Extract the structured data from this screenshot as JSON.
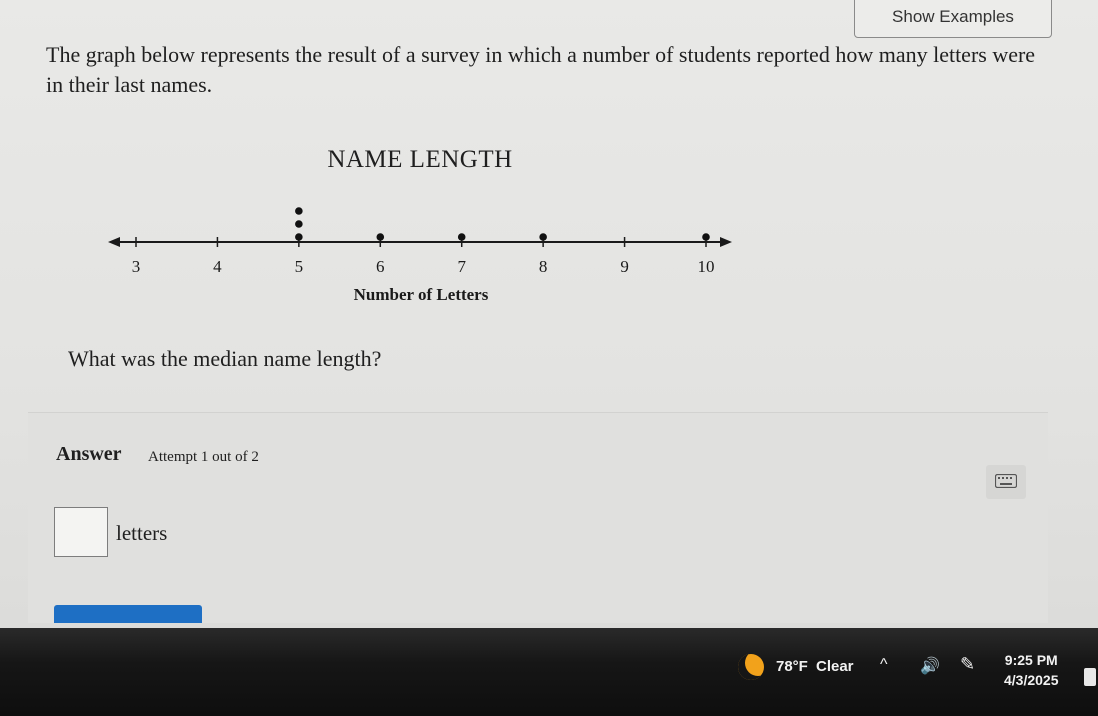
{
  "header": {
    "show_examples_label": "Show Examples"
  },
  "question": {
    "text": "The graph below represents the result of a survey in which a number of students reported how many letters were in their last names.",
    "prompt": "What was the median name length?"
  },
  "chart_data": {
    "type": "scatter",
    "subtype": "dot-plot",
    "title": "NAME LENGTH",
    "xlabel": "Number of Letters",
    "ylabel": "",
    "xlim": [
      3,
      10
    ],
    "ticks": [
      3,
      4,
      5,
      6,
      7,
      8,
      9,
      10
    ],
    "tick_labels": [
      "3",
      "4",
      "5",
      "6",
      "7",
      "8",
      "9",
      "10"
    ],
    "counts": [
      {
        "x": 3,
        "count": 0
      },
      {
        "x": 4,
        "count": 0
      },
      {
        "x": 5,
        "count": 3
      },
      {
        "x": 6,
        "count": 1
      },
      {
        "x": 7,
        "count": 1
      },
      {
        "x": 8,
        "count": 1
      },
      {
        "x": 9,
        "count": 0
      },
      {
        "x": 10,
        "count": 1
      }
    ],
    "grid": false
  },
  "answer": {
    "label": "Answer",
    "attempt": "Attempt 1 out of 2",
    "input_value": "",
    "unit": "letters"
  },
  "taskbar": {
    "temperature": "78°F",
    "weather": "Clear",
    "time": "9:25 PM",
    "date": "4/3/2025"
  }
}
